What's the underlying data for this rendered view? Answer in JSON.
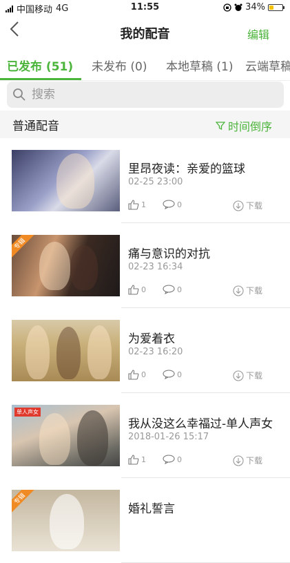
{
  "status_bar": {
    "carrier": "中国移动",
    "network": "4G",
    "time": "11:55",
    "battery": "34%",
    "battery_level": 0.34
  },
  "nav": {
    "title": "我的配音",
    "edit_label": "编辑"
  },
  "tabs": [
    {
      "label": "已发布 (51)",
      "active": true
    },
    {
      "label": "未发布 (0)",
      "active": false
    },
    {
      "label": "本地草稿 (1)",
      "active": false
    },
    {
      "label": "云端草稿",
      "active": false
    }
  ],
  "search": {
    "placeholder": "搜索"
  },
  "section": {
    "label": "普通配音",
    "sort_label": "时间倒序"
  },
  "items": [
    {
      "title": "里昂夜读：亲爱的篮球",
      "date": "02-25 23:00",
      "likes": "1",
      "comments": "0",
      "download": "下载",
      "badge": ""
    },
    {
      "title": "痛与意识的对抗",
      "date": "02-23 16:34",
      "likes": "0",
      "comments": "0",
      "download": "下载",
      "badge": "专辑"
    },
    {
      "title": "为爱着衣",
      "date": "02-23 16:20",
      "likes": "0",
      "comments": "0",
      "download": "下载",
      "badge": ""
    },
    {
      "title": "我从没这么幸福过-单人声女",
      "date": "2018-01-26 15:17",
      "likes": "1",
      "comments": "0",
      "download": "下载",
      "badge": "单人声女"
    },
    {
      "title": "婚礼誓言",
      "date": "",
      "likes": "",
      "comments": "",
      "download": "",
      "badge": "专辑"
    }
  ],
  "colors": {
    "accent": "#4bb43a",
    "badge": "#f08a24"
  }
}
